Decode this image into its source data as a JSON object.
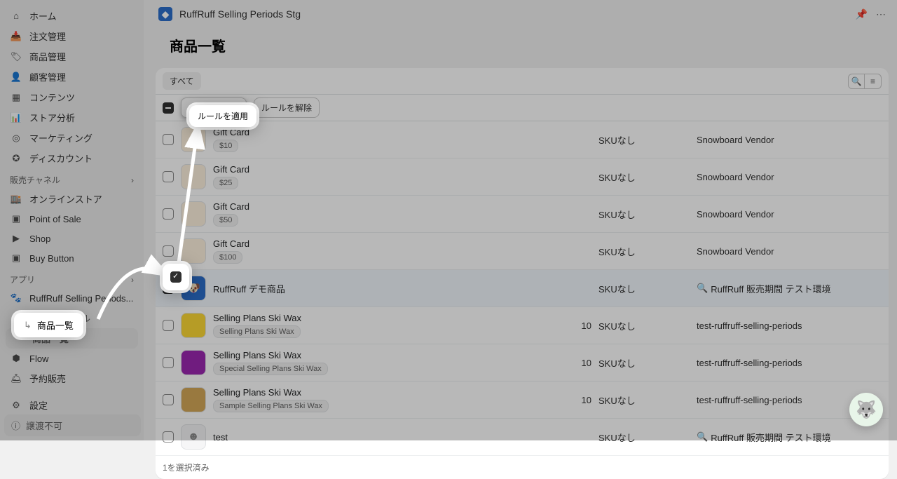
{
  "sidebar": {
    "home": "ホーム",
    "orders": "注文管理",
    "products": "商品管理",
    "customers": "顧客管理",
    "content": "コンテンツ",
    "analytics": "ストア分析",
    "marketing": "マーケティング",
    "discounts": "ディスカウント",
    "channels_header": "販売チャネル",
    "online_store": "オンラインストア",
    "pos": "Point of Sale",
    "shop": "Shop",
    "buy_button": "Buy Button",
    "apps_header": "アプリ",
    "app_ruffruff": "RuffRuff Selling Periods...",
    "app_sub_rules": "販売期間ルール",
    "app_sub_products": "商品一覧",
    "flow": "Flow",
    "preorder": "予約販売",
    "settings": "設定",
    "transfer": "譲渡不可"
  },
  "header": {
    "app_name": "RuffRuff Selling Periods Stg"
  },
  "page": {
    "title": "商品一覧",
    "tab_all": "すべて",
    "bulk": {
      "apply": "ルールを適用",
      "remove": "ルールを解除"
    },
    "footer": "1を選択済み"
  },
  "columns": {
    "sku_none": "SKUなし"
  },
  "rows": [
    {
      "title": "Gift Card",
      "badge": "$10",
      "qty": "",
      "sku": "SKUなし",
      "vendor": "Snowboard Vendor",
      "thumb": "orange",
      "checked": false
    },
    {
      "title": "Gift Card",
      "badge": "$25",
      "qty": "",
      "sku": "SKUなし",
      "vendor": "Snowboard Vendor",
      "thumb": "orange",
      "checked": false
    },
    {
      "title": "Gift Card",
      "badge": "$50",
      "qty": "",
      "sku": "SKUなし",
      "vendor": "Snowboard Vendor",
      "thumb": "orange",
      "checked": false
    },
    {
      "title": "Gift Card",
      "badge": "$100",
      "qty": "",
      "sku": "SKUなし",
      "vendor": "Snowboard Vendor",
      "thumb": "orange",
      "checked": false
    },
    {
      "title": "RuffRuff デモ商品",
      "badge": "",
      "qty": "",
      "sku": "SKUなし",
      "vendor": "RuffRuff 販売期間 テスト環境",
      "vendor_icon": "🔍",
      "thumb": "blue",
      "checked": true
    },
    {
      "title": "Selling Plans Ski Wax",
      "badge": "Selling Plans Ski Wax",
      "qty": "10",
      "sku": "SKUなし",
      "vendor": "test-ruffruff-selling-periods",
      "thumb": "yellow",
      "checked": false
    },
    {
      "title": "Selling Plans Ski Wax",
      "badge": "Special Selling Plans Ski Wax",
      "qty": "10",
      "sku": "SKUなし",
      "vendor": "test-ruffruff-selling-periods",
      "thumb": "purple",
      "checked": false
    },
    {
      "title": "Selling Plans Ski Wax",
      "badge": "Sample Selling Plans Ski Wax",
      "qty": "10",
      "sku": "SKUなし",
      "vendor": "test-ruffruff-selling-periods",
      "thumb": "tan",
      "checked": false
    },
    {
      "title": "test",
      "badge": "",
      "qty": "",
      "sku": "SKUなし",
      "vendor": "RuffRuff 販売期間 テスト環境",
      "vendor_icon": "🔍",
      "thumb": "placeholder",
      "checked": false
    }
  ],
  "highlights": {
    "apply_label": "ルールを適用",
    "nav_label": "商品一覧"
  }
}
